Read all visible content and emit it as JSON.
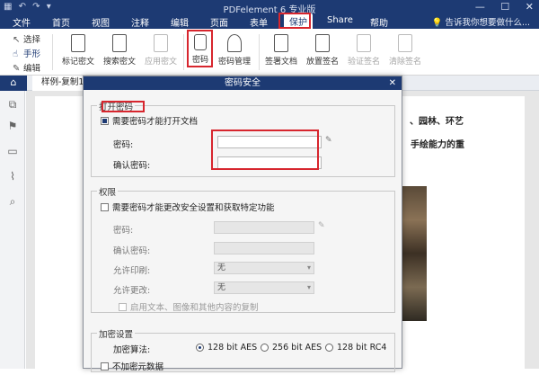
{
  "app": {
    "title": "PDFelement 6 专业版",
    "quick_access": "▦ ↶ ↷ ▾",
    "window_controls": [
      "—",
      "☐",
      "✕"
    ],
    "menu": [
      "文件",
      "首页",
      "视图",
      "注释",
      "编辑",
      "页面",
      "表单",
      "保护",
      "Share",
      "帮助"
    ],
    "active_menu": "保护",
    "tell_me": "告诉我你想要做什么..."
  },
  "ribbon": {
    "modes": [
      "选择",
      "手形",
      "编辑"
    ],
    "buttons": [
      "标记密文",
      "搜索密文",
      "应用密文",
      "密码",
      "密码管理",
      "签署文档",
      "放置签名",
      "验证签名",
      "清除签名"
    ]
  },
  "tab": {
    "home_icon": "⌂",
    "document": "样例-复制1"
  },
  "document": {
    "line1": "、园林、环艺",
    "line2": "手绘能力的重"
  },
  "dialog": {
    "title": "密码安全",
    "close": "✕",
    "open_password": {
      "group_title": "打开密码",
      "require_checkbox": "需要密码才能打开文档",
      "require_checked": true,
      "password_label": "密码:",
      "password_value": "",
      "confirm_label": "确认密码:",
      "confirm_value": ""
    },
    "permissions": {
      "group_title": "权限",
      "require_checkbox": "需要密码才能更改安全设置和获取特定功能",
      "require_checked": false,
      "password_label": "密码:",
      "confirm_label": "确认密码:",
      "print_label": "允许印刷:",
      "print_value": "无",
      "change_label": "允许更改:",
      "change_value": "无",
      "copy_checkbox": "启用文本、图像和其他内容的复制"
    },
    "encryption": {
      "group_title": "加密设置",
      "algorithm_label": "加密算法:",
      "options": [
        "128 bit AES",
        "256 bit AES",
        "128 bit RC4"
      ],
      "selected": "128 bit AES",
      "metadata_checkbox": "不加密元数据"
    }
  },
  "colors": {
    "brand": "#1d3a73",
    "highlight": "#d7262e"
  }
}
